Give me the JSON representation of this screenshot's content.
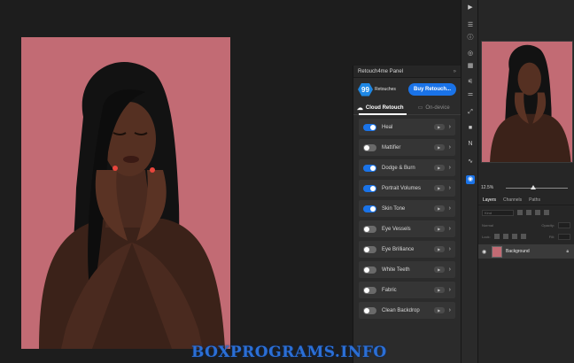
{
  "panel": {
    "title": "Retouch4me Panel",
    "collapse_glyph": "»",
    "count": "99",
    "count_label": "Retouches",
    "buy_label": "Buy Retouch...",
    "tabs": [
      {
        "label": "Cloud Retouch",
        "icon": "cloud-icon"
      },
      {
        "label": "On-device",
        "icon": "monitor-icon"
      }
    ],
    "items": [
      {
        "label": "Heal",
        "enabled": true
      },
      {
        "label": "Mattifier",
        "enabled": false
      },
      {
        "label": "Dodge & Burn",
        "enabled": true
      },
      {
        "label": "Portrait Volumes",
        "enabled": true
      },
      {
        "label": "Skin Tone",
        "enabled": true
      },
      {
        "label": "Eye Vessels",
        "enabled": false
      },
      {
        "label": "Eye Brilliance",
        "enabled": false
      },
      {
        "label": "White Teeth",
        "enabled": false
      },
      {
        "label": "Fabric",
        "enabled": false
      },
      {
        "label": "Clean Backdrop",
        "enabled": false
      }
    ]
  },
  "navigator": {
    "zoom": "12.5%"
  },
  "layers_panel": {
    "tabs": [
      "Layers",
      "Channels",
      "Paths"
    ],
    "kind_label": "Kind",
    "blend_label": "Normal",
    "opacity_label": "Opacity:",
    "lock_label": "Lock:",
    "fill_label": "Fill:",
    "layer_name": "Background"
  },
  "watermark": "BOXPROGRAMS.INFO",
  "colors": {
    "backdrop": "#c26b74",
    "accent": "#1a73e8"
  }
}
